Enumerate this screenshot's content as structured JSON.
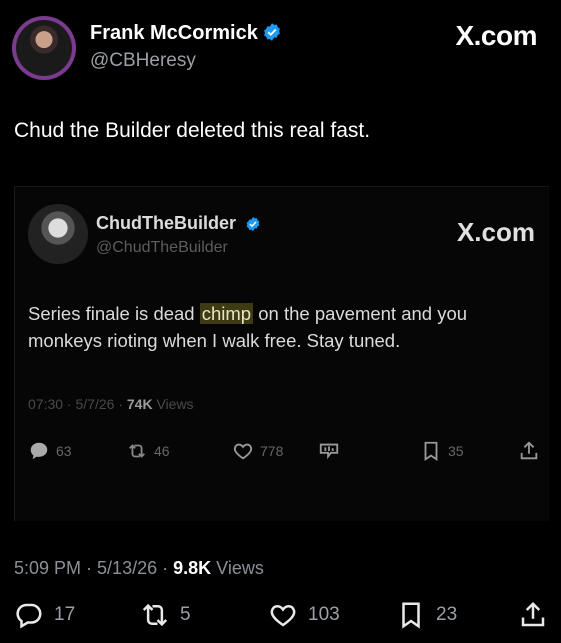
{
  "author": {
    "name": "Frank McCormick",
    "handle": "@CBHeresy",
    "site": "X.com"
  },
  "tweet": {
    "text": "Chud the Builder deleted this real fast.",
    "time": "5:09 PM",
    "date": "5/13/26",
    "views_count": "9.8K",
    "views_label": "Views",
    "replies": "17",
    "reposts": "5",
    "likes": "103",
    "bookmarks": "23"
  },
  "quote": {
    "name": "ChudTheBuilder",
    "handle": "@ChudTheBuilder",
    "site": "X.com",
    "text_before": "Series finale is dead ",
    "text_highlight": "chimp",
    "text_after": " on the pavement and you monkeys rioting when I walk free. Stay tuned.",
    "time": "07:30",
    "date": "5/7/26",
    "views_count": "74K",
    "views_label": "Views",
    "replies": "63",
    "reposts": "46",
    "likes": "778",
    "bookmarks": "35"
  },
  "colors": {
    "verified": "#1d9bf0",
    "highlight": "#3e3a12",
    "background": "#000000"
  }
}
